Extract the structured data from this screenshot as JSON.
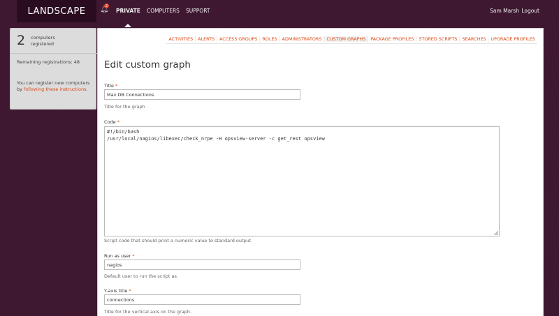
{
  "app": {
    "logo": "LANDSCAPE",
    "alerts_count": "2"
  },
  "nav": {
    "private": "PRIVATE",
    "computers": "COMPUTERS",
    "support": "SUPPORT"
  },
  "user": {
    "name": "Sam Marsh",
    "logout": "Logout"
  },
  "info": {
    "count": "2",
    "count_label": "computers registered",
    "remaining": "Remaining registrations: 48",
    "register_prefix": "You can register new computers by ",
    "register_link": "following these instructions",
    "register_suffix": "."
  },
  "tabs": [
    {
      "label": "ACTIVITIES"
    },
    {
      "label": "ALERTS"
    },
    {
      "label": "ACCESS GROUPS"
    },
    {
      "label": "ROLES"
    },
    {
      "label": "ADMINISTRATORS"
    },
    {
      "label": "CUSTOM GRAPHS"
    },
    {
      "label": "PACKAGE PROFILES"
    },
    {
      "label": "STORED SCRIPTS"
    },
    {
      "label": "SEARCHES"
    },
    {
      "label": "UPGRADE PROFILES"
    }
  ],
  "form": {
    "heading": "Edit custom graph",
    "title": {
      "label": "Title",
      "required": "*",
      "value": "Max DB Connections",
      "help": "Title for the graph"
    },
    "code": {
      "label": "Code",
      "required": "*",
      "value": "#!/bin/bash\n/usr/local/nagios/libexec/check_nrpe -H opsview-server -c get_rest opsview",
      "help": "Script code that should print a numeric value to standard output"
    },
    "run_as": {
      "label": "Run as user",
      "required": "*",
      "value": "nagios",
      "help": "Default user to run the script as."
    },
    "y_axis": {
      "label": "Y-axis title",
      "required": "*",
      "value": "connections",
      "help": "Title for the vertical axis on the graph."
    }
  },
  "colors": {
    "accent": "#dd4814",
    "background": "#3e1630",
    "logo_bg": "#2a0c20"
  }
}
